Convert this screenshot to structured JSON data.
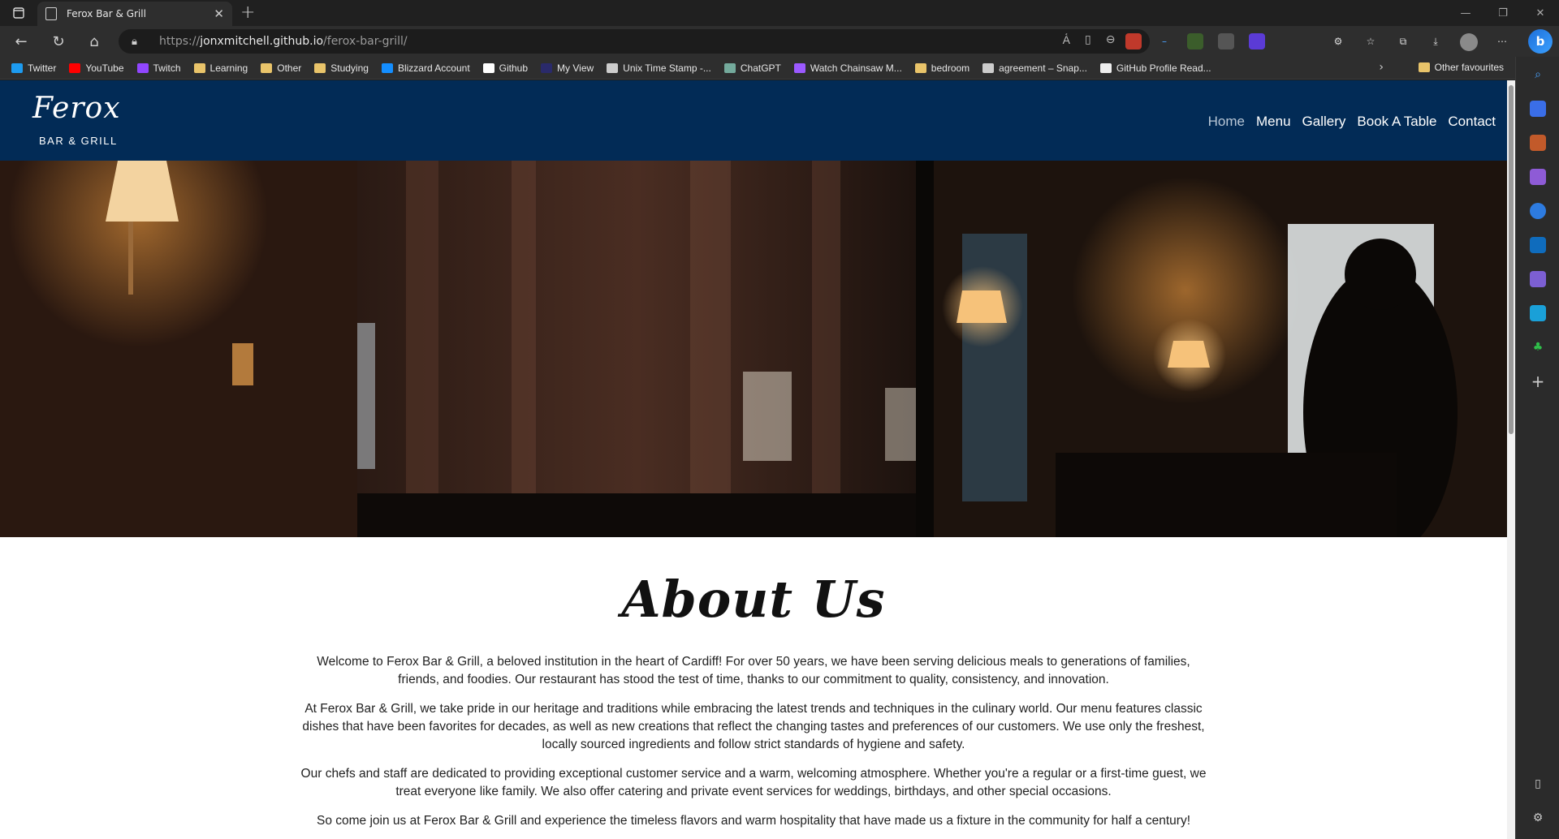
{
  "browser": {
    "tab": {
      "title": "Ferox Bar & Grill"
    },
    "address": {
      "prefix": "https://",
      "host": "jonxmitchell.github.io",
      "path": "/ferox-bar-grill/"
    },
    "bookmarks": [
      {
        "label": "Twitter",
        "icon": "twitter-icon",
        "color": "#1d9bf0"
      },
      {
        "label": "YouTube",
        "icon": "youtube-icon",
        "color": "#ff0000"
      },
      {
        "label": "Twitch",
        "icon": "twitch-icon",
        "color": "#9146ff"
      },
      {
        "label": "Learning",
        "icon": "folder-icon",
        "color": "#e9c46a"
      },
      {
        "label": "Other",
        "icon": "folder-icon",
        "color": "#e9c46a"
      },
      {
        "label": "Studying",
        "icon": "folder-icon",
        "color": "#e9c46a"
      },
      {
        "label": "Blizzard Account",
        "icon": "blizzard-icon",
        "color": "#148eff"
      },
      {
        "label": "Github",
        "icon": "github-icon",
        "color": "#ffffff"
      },
      {
        "label": "My View",
        "icon": "myview-icon",
        "color": "#2a2a6a"
      },
      {
        "label": "Unix Time Stamp -...",
        "icon": "page-icon",
        "color": "#cccccc"
      },
      {
        "label": "ChatGPT",
        "icon": "chatgpt-icon",
        "color": "#74aa9c"
      },
      {
        "label": "Watch Chainsaw M...",
        "icon": "crunchyroll-icon",
        "color": "#9b59ff"
      },
      {
        "label": "bedroom",
        "icon": "folder-icon",
        "color": "#e9c46a"
      },
      {
        "label": "agreement – Snap...",
        "icon": "snap-icon",
        "color": "#cccccc"
      },
      {
        "label": "GitHub Profile Read...",
        "icon": "readme-icon",
        "color": "#eeeeee"
      }
    ],
    "other_favourites": "Other favourites"
  },
  "site": {
    "logo": {
      "script": "Ferox",
      "sub": "BAR & GRILL"
    },
    "nav": [
      {
        "label": "Home",
        "active": true
      },
      {
        "label": "Menu",
        "active": false
      },
      {
        "label": "Gallery",
        "active": false
      },
      {
        "label": "Book A Table",
        "active": false
      },
      {
        "label": "Contact",
        "active": false
      }
    ],
    "header_color": "#022b56",
    "about": {
      "title": "About Us",
      "paragraphs": [
        "Welcome to Ferox Bar & Grill, a beloved institution in the heart of Cardiff! For over 50 years, we have been serving delicious meals to generations of families, friends, and foodies. Our restaurant has stood the test of time, thanks to our commitment to quality, consistency, and innovation.",
        "At Ferox Bar & Grill, we take pride in our heritage and traditions while embracing the latest trends and techniques in the culinary world. Our menu features classic dishes that have been favorites for decades, as well as new creations that reflect the changing tastes and preferences of our customers. We use only the freshest, locally sourced ingredients and follow strict standards of hygiene and safety.",
        "Our chefs and staff are dedicated to providing exceptional customer service and a warm, welcoming atmosphere. Whether you're a regular or a first-time guest, we treat everyone like family. We also offer catering and private event services for weddings, birthdays, and other special occasions.",
        "So come join us at Ferox Bar & Grill and experience the timeless flavors and warm hospitality that have made us a fixture in the community for half a century!"
      ]
    }
  }
}
